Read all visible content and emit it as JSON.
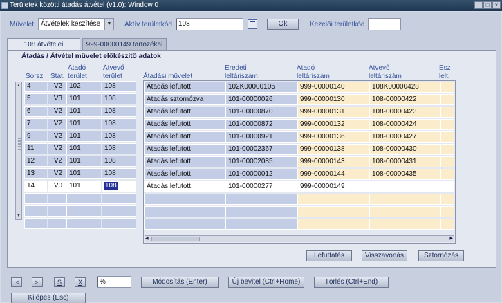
{
  "window": {
    "title": "Területek közötti átadás átvétel (v1.0): Window 0",
    "buttons": [
      "_",
      "□",
      "×"
    ]
  },
  "filter": {
    "muvelet_label": "Művelet",
    "muvelet_value": "Átvételek készítése",
    "aktiv_label": "Aktív területkód",
    "aktiv_value": "108",
    "ok_label": "Ok",
    "kezeloi_label": "Kezelői területkód",
    "kezeloi_value": ""
  },
  "tabs": [
    {
      "label": "108 átvételei",
      "active": true
    },
    {
      "label": "999-00000149 tartozékai",
      "active": false
    }
  ],
  "section_title": "Átadás / Átvétel művelet  előkészítő adatok",
  "left_headers": {
    "sorsz": "Sorsz",
    "stat": "Stát.",
    "atado": [
      "Átadó",
      "terület"
    ],
    "atvevo": [
      "Átvevő",
      "terület"
    ]
  },
  "right_headers": {
    "muvelet": "Átadási művelet",
    "eredeti": [
      "Eredeti",
      "leltáriszám"
    ],
    "atado": [
      "Átadó",
      "leltáriszám"
    ],
    "atvevo": [
      "Átvevő",
      "leltáriszám"
    ],
    "esz": [
      "Esz",
      "lelt."
    ]
  },
  "rows": [
    {
      "sorsz": "4",
      "stat": "V2",
      "atado_ter": "102",
      "atvevo_ter": "108",
      "muvelet": "Átadás lefutott",
      "eredeti": "102K00000105",
      "atado_lelt": "999-00000140",
      "atvevo_lelt": "108K00000428"
    },
    {
      "sorsz": "5",
      "stat": "V3",
      "atado_ter": "101",
      "atvevo_ter": "108",
      "muvelet": "Átadás sztornózva",
      "eredeti": "101-00000026",
      "atado_lelt": "999-00000130",
      "atvevo_lelt": "108-00000422"
    },
    {
      "sorsz": "6",
      "stat": "V2",
      "atado_ter": "101",
      "atvevo_ter": "108",
      "muvelet": "Átadás lefutott",
      "eredeti": "101-00000870",
      "atado_lelt": "999-00000131",
      "atvevo_lelt": "108-00000423"
    },
    {
      "sorsz": "7",
      "stat": "V2",
      "atado_ter": "101",
      "atvevo_ter": "108",
      "muvelet": "Átadás lefutott",
      "eredeti": "101-00000872",
      "atado_lelt": "999-00000132",
      "atvevo_lelt": "108-00000424"
    },
    {
      "sorsz": "9",
      "stat": "V2",
      "atado_ter": "101",
      "atvevo_ter": "108",
      "muvelet": "Átadás lefutott",
      "eredeti": "101-00000921",
      "atado_lelt": "999-00000136",
      "atvevo_lelt": "108-00000427"
    },
    {
      "sorsz": "11",
      "stat": "V2",
      "atado_ter": "101",
      "atvevo_ter": "108",
      "muvelet": "Átadás lefutott",
      "eredeti": "101-00002367",
      "atado_lelt": "999-00000138",
      "atvevo_lelt": "108-00000430"
    },
    {
      "sorsz": "12",
      "stat": "V2",
      "atado_ter": "101",
      "atvevo_ter": "108",
      "muvelet": "Átadás lefutott",
      "eredeti": "101-00002085",
      "atado_lelt": "999-00000143",
      "atvevo_lelt": "108-00000431"
    },
    {
      "sorsz": "13",
      "stat": "V2",
      "atado_ter": "101",
      "atvevo_ter": "108",
      "muvelet": "Átadás lefutott",
      "eredeti": "101-00000012",
      "atado_lelt": "999-00000144",
      "atvevo_lelt": "108-00000435"
    },
    {
      "sorsz": "14",
      "stat": "V0",
      "atado_ter": "101",
      "atvevo_ter": "108",
      "muvelet": "Átadás lefutott",
      "eredeti": "101-00000277",
      "atado_lelt": "999-00000149",
      "atvevo_lelt": ""
    }
  ],
  "actions": {
    "lefuttatas": "Lefuttatás",
    "visszavonas": "Visszavonás",
    "sztornozas": "Sztornózás"
  },
  "bottom": {
    "nav_first": "|<",
    "nav_last": ">|",
    "nav_save": "S",
    "nav_x": "X",
    "percent": "%",
    "modositas": "Módosítás (Enter)",
    "uj_bevitel": "Új bevitel (Ctrl+Home)",
    "torles": "Törlés (Ctrl+End)",
    "kilepes": "Kilépés (Esc)"
  }
}
